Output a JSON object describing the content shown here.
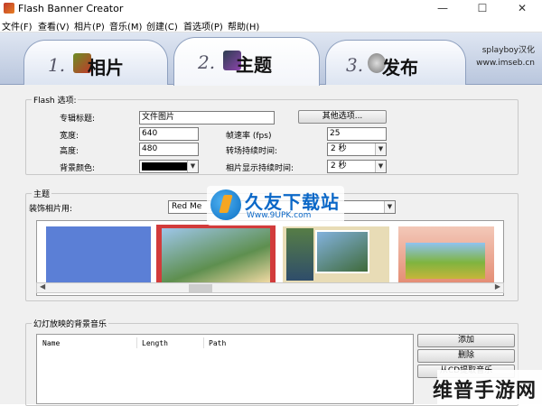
{
  "window": {
    "title": "Flash Banner Creator"
  },
  "menu": [
    "文件(F)",
    "查看(V)",
    "相片(P)",
    "音乐(M)",
    "创建(C)",
    "首选项(P)",
    "帮助(H)"
  ],
  "tabs": [
    {
      "number": "1.",
      "label": "相片"
    },
    {
      "number": "2.",
      "label": "主题"
    },
    {
      "number": "3.",
      "label": "发布"
    }
  ],
  "brand": {
    "line1": "splayboy汉化",
    "line2": "www.imseb.cn"
  },
  "flash_options": {
    "title": "Flash 选项:",
    "album_title_label": "专辑标题:",
    "album_title_value": "文件图片",
    "other_options_button": "其他选项...",
    "width_label": "宽度:",
    "width_value": "640",
    "framerate_label": "帧速率 (fps)",
    "framerate_value": "25",
    "height_label": "高度:",
    "height_value": "480",
    "transition_label": "转场持续时间:",
    "transition_value": "2 秒",
    "bgcolor_label": "背景颜色:",
    "bgcolor_value": "#000000",
    "display_label": "相片显示持续时间:",
    "display_value": "2 秒"
  },
  "theme": {
    "title": "主题",
    "decorate_label": "装饰相片用:",
    "decorate_value": "Red Me"
  },
  "music": {
    "title": "幻灯放映的背景音乐",
    "columns": [
      "Name",
      "Length",
      "Path"
    ],
    "add_button": "添加",
    "delete_button": "删除",
    "extract_button": "从CD提取音乐"
  },
  "watermarks": {
    "site_name": "久友下载站",
    "site_url": "Www.9UPK.com",
    "corner": "维普手游网"
  }
}
